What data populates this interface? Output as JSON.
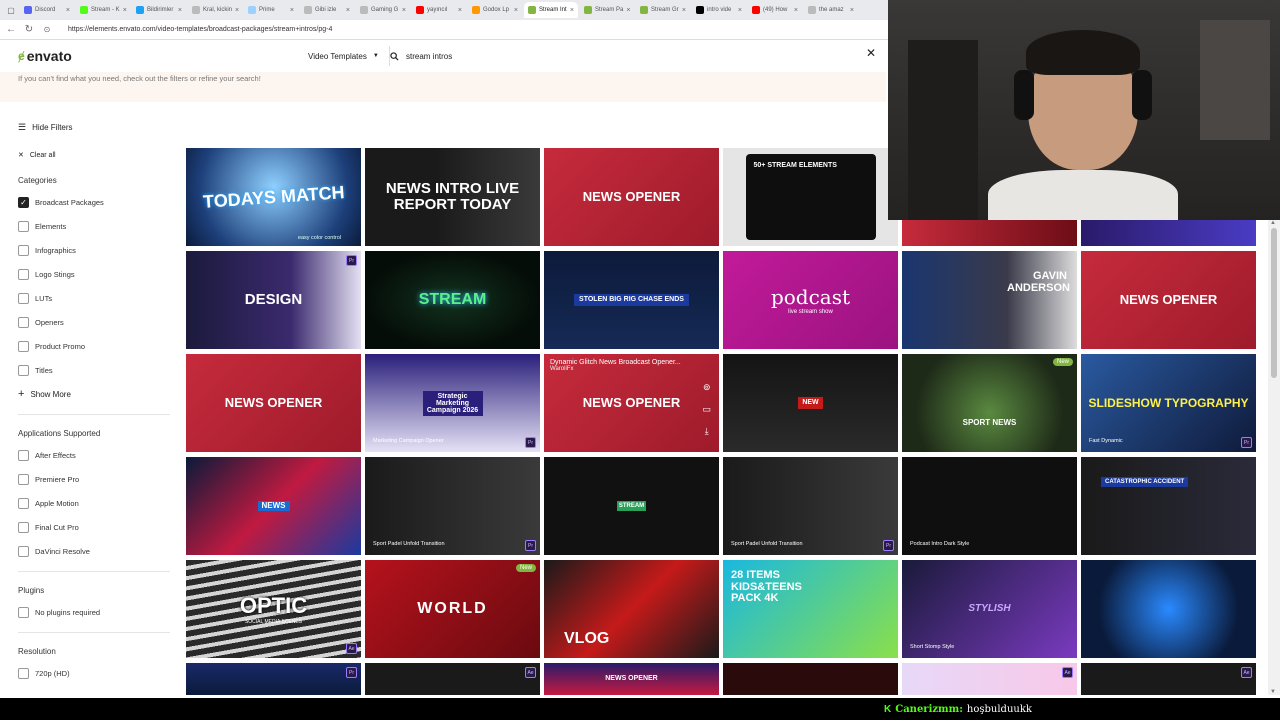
{
  "browser": {
    "tabs": [
      {
        "label": "Discord",
        "color": "#5865f2",
        "active": false
      },
      {
        "label": "Stream - K",
        "color": "#53fc18",
        "active": false
      },
      {
        "label": "Bildirimler",
        "color": "#1da1f2",
        "active": false
      },
      {
        "label": "Kral, kickin",
        "color": "#bbbbbb",
        "active": false
      },
      {
        "label": "Prime",
        "color": "#9bd0ff",
        "active": false
      },
      {
        "label": "Gibi izle",
        "color": "#bbbbbb",
        "active": false
      },
      {
        "label": "Gaming G",
        "color": "#bbbbbb",
        "active": false
      },
      {
        "label": "yayıncıl",
        "color": "#ff0000",
        "active": false
      },
      {
        "label": "Godox Lp",
        "color": "#ff9900",
        "active": false
      },
      {
        "label": "Stream Int",
        "color": "#82b541",
        "active": true
      },
      {
        "label": "Stream Pa",
        "color": "#82b541",
        "active": false
      },
      {
        "label": "Stream Gr",
        "color": "#82b541",
        "active": false
      },
      {
        "label": "intro vide",
        "color": "#000000",
        "active": false
      },
      {
        "label": "(49) How",
        "color": "#ff0000",
        "active": false
      },
      {
        "label": "the amaz",
        "color": "#bbbbbb",
        "active": false
      }
    ],
    "url": "https://elements.envato.com/video-templates/broadcast-packages/stream+intros/pg-4"
  },
  "header": {
    "logo": "envato",
    "category": "Video Templates",
    "search_value": "stream intros"
  },
  "notice": "If you can't find what you need, check out the filters or refine your search!",
  "sidebar": {
    "hide_filters": "Hide Filters",
    "clear_all": "Clear all",
    "categories_title": "Categories",
    "categories": [
      {
        "label": "Broadcast Packages",
        "checked": true
      },
      {
        "label": "Elements",
        "checked": false
      },
      {
        "label": "Infographics",
        "checked": false
      },
      {
        "label": "Logo Stings",
        "checked": false
      },
      {
        "label": "LUTs",
        "checked": false
      },
      {
        "label": "Openers",
        "checked": false
      },
      {
        "label": "Product Promo",
        "checked": false
      },
      {
        "label": "Titles",
        "checked": false
      }
    ],
    "show_more": "Show More",
    "apps_title": "Applications Supported",
    "apps": [
      {
        "label": "After Effects",
        "checked": false
      },
      {
        "label": "Premiere Pro",
        "checked": false
      },
      {
        "label": "Apple Motion",
        "checked": false
      },
      {
        "label": "Final Cut Pro",
        "checked": false
      },
      {
        "label": "DaVinci Resolve",
        "checked": false
      }
    ],
    "plugins_title": "Plugins",
    "plugins": [
      {
        "label": "No plugins required",
        "checked": false
      }
    ],
    "resolution_title": "Resolution",
    "resolution": [
      {
        "label": "720p (HD)",
        "checked": false
      }
    ]
  },
  "tiles": {
    "t00": "TODAYS MATCH",
    "t00_sub": "easy color control",
    "t01": "NEWS INTRO  LIVE REPORT TODAY",
    "t02": "NEWS OPENER",
    "t03": "50+ STREAM ELEMENTS",
    "t10": "DESIGN",
    "t11": "STREAM",
    "t12": "STOLEN BIG RIG CHASE ENDS",
    "t13": "podcast",
    "t13_sub": "live stream show",
    "t14": "GAVIN ANDERSON",
    "t15": "NEWS OPENER",
    "t20": "NEWS OPENER",
    "t21": "Strategic Marketing Campaign 2026",
    "t21_sub": "Marketing Campaign Opener",
    "t22": "NEWS OPENER",
    "t22_hover_title": "Dynamic Glitch News Broadcast Opener...",
    "t22_hover_author": "WaroliFx",
    "t23": "NEW",
    "t24": "SPORT NEWS",
    "t24_badge": "New",
    "t25": "SLIDESHOW  TYPOGRAPHY",
    "t25_sub": "Fast Dynamic",
    "t30": "NEWS",
    "t31_sub": "Sport Padel Unfold Transition",
    "t32": "STREAM",
    "t33_sub": "Sport Padel Unfold Transition",
    "t34_sub": "Podcast Intro Dark Style",
    "t35": "CATASTROPHIC ACCIDENT",
    "t40": "OPTIC",
    "t40_sub": "SOCIAL MEDIA SCENES",
    "t41": "WORLD",
    "t41_badge": "New",
    "t42": "VLOG",
    "t43": "28 ITEMS KIDS&TEENS PACK 4K",
    "t44": "STYLISH",
    "t44_sub": "Short Stomp Style",
    "t52": "NEWS OPENER"
  },
  "colors": {
    "accent": "#82b541",
    "kick_green": "#53fc18"
  },
  "chat": {
    "platform_icon": "K",
    "username": "Canerizmm:",
    "message": "hoşbulduukk"
  }
}
